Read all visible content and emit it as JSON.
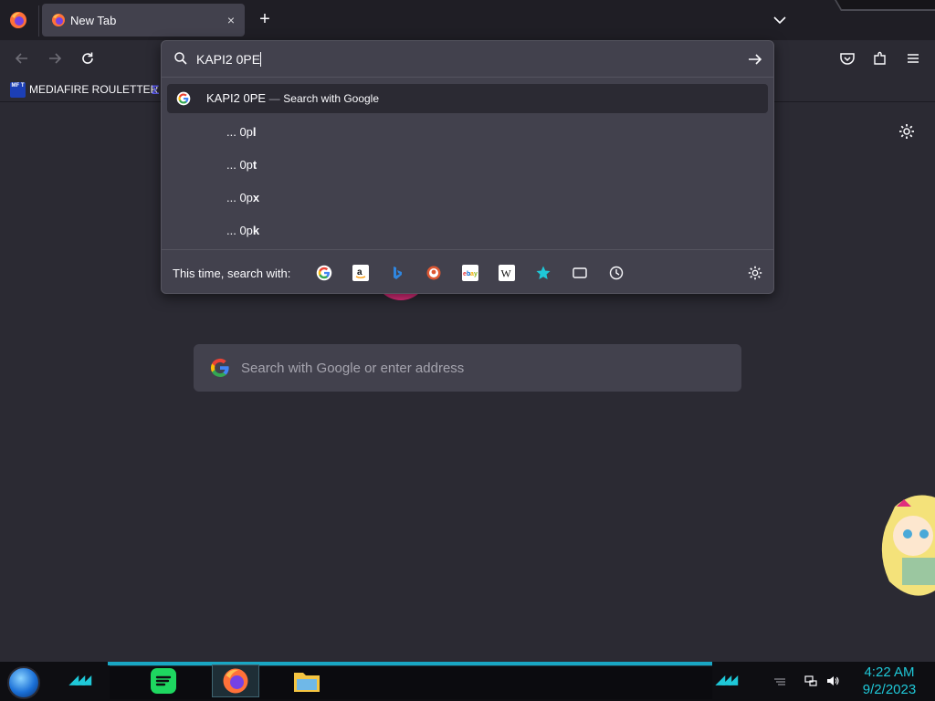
{
  "tabs": [
    {
      "title": "New Tab",
      "close_symbol": "×"
    }
  ],
  "new_tab_symbol": "+",
  "bookmarks": {
    "items": [
      {
        "icon_text": "MF T",
        "label": "MEDIAFIRE ROULETTER"
      }
    ],
    "more_symbol": "Σ"
  },
  "urlbar": {
    "value": "KAPI2 0PE",
    "top_result": {
      "query": "KAPI2 0PE",
      "separator": "—",
      "action": "Search with Google"
    },
    "suggestions": [
      {
        "prefix": "... 0p",
        "suffix": "l"
      },
      {
        "prefix": "... 0p",
        "suffix": "t"
      },
      {
        "prefix": "... 0p",
        "suffix": "x"
      },
      {
        "prefix": "... 0p",
        "suffix": "k"
      }
    ],
    "one_off_label": "This time, search with:",
    "engines": [
      "google",
      "amazon",
      "bing",
      "duckduckgo",
      "ebay",
      "wikipedia",
      "bookmarks-star",
      "tabs",
      "history"
    ]
  },
  "page": {
    "search_placeholder": "Search with Google or enter address"
  },
  "taskbar": {
    "time": "4:22 AM",
    "date": "9/2/2023",
    "pinned": [
      "spotify",
      "firefox",
      "file-explorer"
    ]
  },
  "colors": {
    "background": "#2b2a33",
    "panel": "#42414d",
    "accent_cyan": "#1fc8d8",
    "pink": "#e02e7d"
  }
}
